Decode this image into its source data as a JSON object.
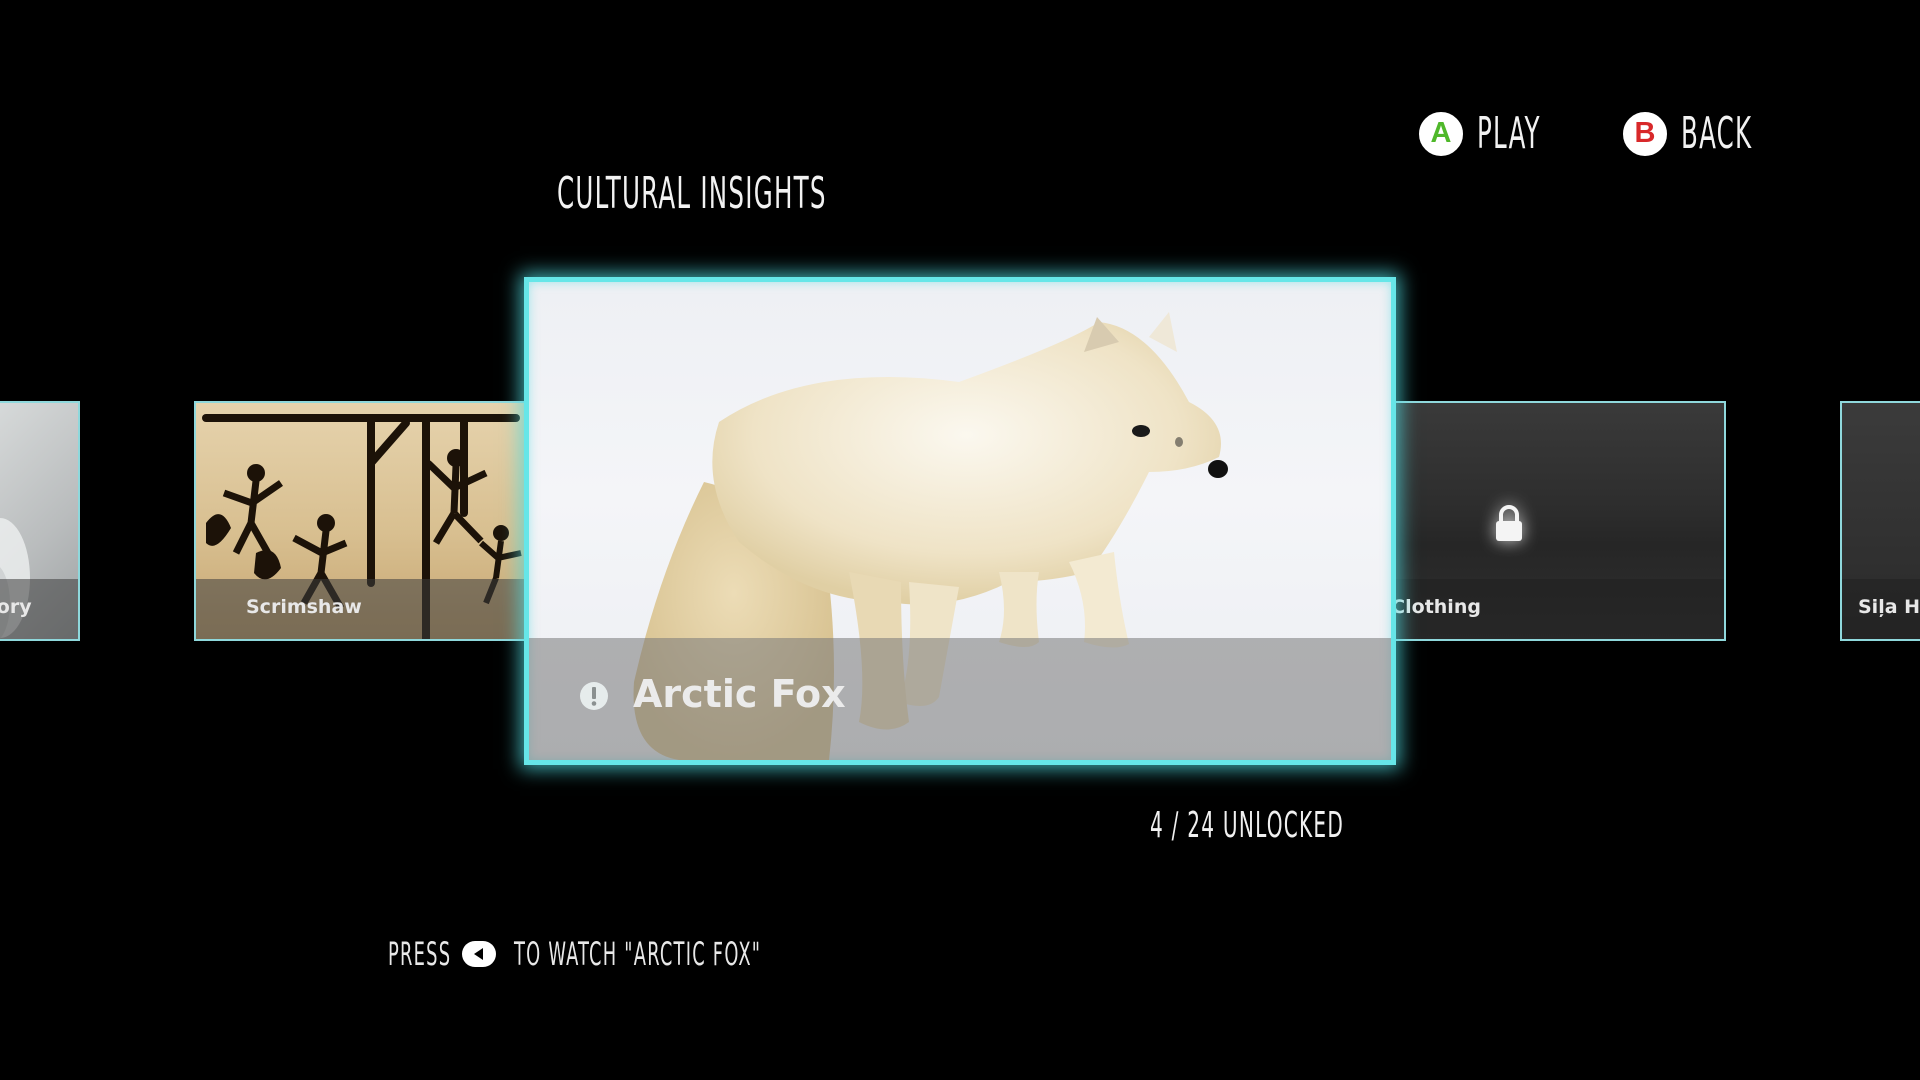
{
  "controls": {
    "play": {
      "key": "A",
      "label": "PLAY",
      "color": "#4fb82a"
    },
    "back": {
      "key": "B",
      "label": "BACK",
      "color": "#d8282a"
    }
  },
  "section_title": "CULTURAL INSIGHTS",
  "carousel": {
    "items": [
      {
        "label": "Story",
        "locked": false
      },
      {
        "label": "Scrimshaw",
        "locked": false
      },
      {
        "label": "Arctic Fox",
        "locked": false,
        "selected": true,
        "new_indicator": "!"
      },
      {
        "label": "& Clothing",
        "locked": true
      },
      {
        "label": "Siļa Ha",
        "locked": true
      }
    ]
  },
  "progress": {
    "text": "4 / 24 UNLOCKED",
    "unlocked": 4,
    "total": 24
  },
  "hint": {
    "pre": "PRESS",
    "icon": "dpad-left-icon",
    "post": "TO WATCH \"ARCTIC FOX\""
  },
  "accent_color": "#66e6e8"
}
